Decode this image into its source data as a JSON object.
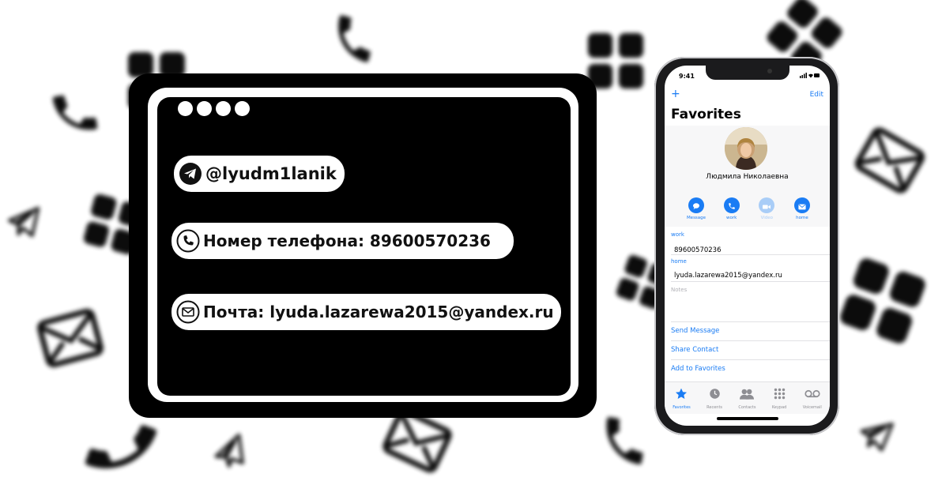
{
  "card": {
    "telegram_handle": "@lyudm1lanik",
    "phone_line": "Номер телефона: 89600570236",
    "email_line": "Почта: lyuda.lazarewa2015@yandex.ru"
  },
  "phone_ui": {
    "status_time": "9:41",
    "nav_add": "+",
    "nav_edit": "Edit",
    "title": "Favorites",
    "contact_name": "Людмила Николаевна",
    "actions": [
      {
        "label": "Message",
        "icon": "message-icon",
        "enabled": true
      },
      {
        "label": "work",
        "icon": "phone-icon",
        "enabled": true
      },
      {
        "label": "Video",
        "icon": "video-icon",
        "enabled": false
      },
      {
        "label": "home",
        "icon": "mail-icon",
        "enabled": true
      }
    ],
    "fields": [
      {
        "label": "work",
        "value": "89600570236"
      },
      {
        "label": "home",
        "value": "lyuda.lazarewa2015@yandex.ru"
      }
    ],
    "notes_placeholder": "Notes",
    "links": [
      "Send Message",
      "Share Contact",
      "Add to Favorites"
    ],
    "tabs": [
      {
        "label": "Favorites",
        "icon": "star-icon",
        "active": true
      },
      {
        "label": "Recents",
        "icon": "clock-icon",
        "active": false
      },
      {
        "label": "Contacts",
        "icon": "contacts-icon",
        "active": false
      },
      {
        "label": "Keypad",
        "icon": "keypad-icon",
        "active": false
      },
      {
        "label": "Voicemail",
        "icon": "voicemail-icon",
        "active": false
      }
    ],
    "accent_color": "#1a7cf4"
  },
  "decor_icons": [
    "phone-icon",
    "mail-icon",
    "telegram-icon",
    "grid-icon"
  ]
}
